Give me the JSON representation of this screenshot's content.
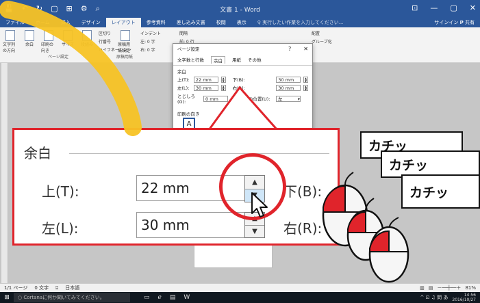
{
  "titlebar": {
    "doc_title": "文書 1 - Word",
    "qat": [
      "💾",
      "↶",
      "↻",
      "▢",
      "⊞",
      "⚙",
      "⌕"
    ],
    "win_controls": [
      "⊡",
      "—",
      "▢",
      "✕"
    ]
  },
  "ribbon": {
    "tabs": [
      "ファイル",
      "ホーム",
      "挿入",
      "デザイン",
      "レイアウト",
      "参考資料",
      "差し込み文書",
      "校閲",
      "表示"
    ],
    "active_tab": "レイアウト",
    "tell_me": "♀ 実行したい作業を入力してください...",
    "user": "サインイン  𝝦 共有",
    "group_labels": {
      "page_setup": "ページ設定",
      "manuscript": "原稿用紙"
    },
    "buttons": {
      "text_direction": "文字列の方向",
      "margins": "余白",
      "orientation": "印刷の向き",
      "size": "サイズ",
      "columns": "段組み",
      "breaks": "区切り",
      "line_numbers": "行番号",
      "hyphenation": "ハイフネーション",
      "manuscript_settings": "原稿用紙設定",
      "indent_label": "インデント",
      "indent_left": "左: 0 字",
      "indent_right": "右: 0 字",
      "spacing_label": "間隔",
      "spacing_before": "前: 0 行",
      "position": "配置",
      "group": "グループ化"
    }
  },
  "dialog": {
    "title": "ページ設定",
    "tabs": [
      "文字数と行数",
      "余白",
      "用紙",
      "その他"
    ],
    "active_tab": "余白",
    "section_margins": "余白",
    "top_label": "上(T):",
    "top_value": "22 mm",
    "bottom_label": "下(B):",
    "bottom_value": "30 mm",
    "left_label": "左(L):",
    "left_value": "30 mm",
    "right_label": "右(R):",
    "right_value": "30 mm",
    "gutter_label": "とじしろ(G):",
    "gutter_value": "0 mm",
    "gutter_pos_label": "とじしろの位置(U):",
    "gutter_pos_value": "左",
    "orientation_label": "印刷の向き",
    "help": "?",
    "close": "✕"
  },
  "zoom": {
    "section": "余白",
    "top_label": "上(T):",
    "top_value": "22 mm",
    "bottom_label": "下(B):",
    "left_label": "左(L):",
    "left_value": "30 mm",
    "right_label": "右(R):"
  },
  "bubbles": [
    "カチッ",
    "カチッ",
    "カチッ"
  ],
  "statusbar": {
    "page": "1/1 ページ",
    "words": "0 文字",
    "lang_icon": "⌹",
    "lang": "日本語",
    "zoom": "81%"
  },
  "taskbar": {
    "start": "⊞",
    "cortana": "○ Cortanaに何か聞いてみてください。",
    "apps": [
      "▭",
      "ℯ",
      "▤",
      "W"
    ],
    "tray": "^ ⊡ ♫ 問 あ",
    "time": "14:56",
    "date": "2016/10/27"
  },
  "colors": {
    "accent": "#2b579a",
    "callout": "#e0242b",
    "marker": "#f7c325"
  }
}
